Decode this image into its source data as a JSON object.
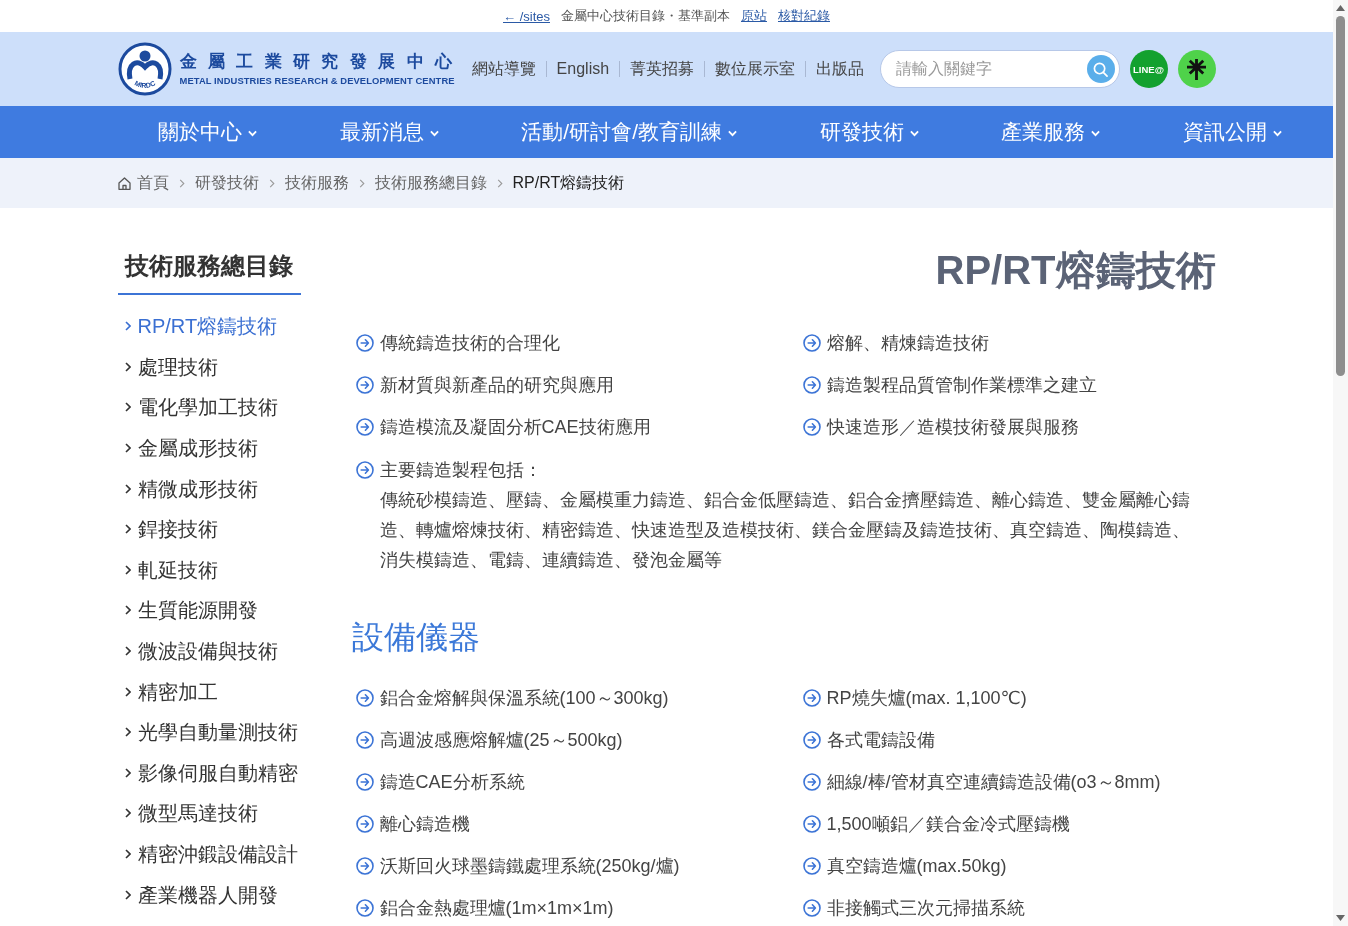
{
  "top_bar": {
    "back_link": "← /sites",
    "caption": "金屬中心技術目錄・基準副本",
    "links": [
      "原站",
      "核對紀錄"
    ]
  },
  "header": {
    "logo": {
      "emblem_text": "MIRDC",
      "name": "金屬工業研究發展中心",
      "name_en": "METAL INDUSTRIES RESEARCH & DEVELOPMENT CENTRE"
    },
    "links": [
      "網站導覽",
      "English",
      "菁英招募",
      "數位展示室",
      "出版品"
    ],
    "search": {
      "placeholder": "請輸入關鍵字"
    },
    "social_buttons": [
      {
        "kind": "label",
        "label": "LINE@"
      },
      {
        "kind": "asterisk"
      }
    ]
  },
  "main_nav": [
    "關於中心",
    "最新消息",
    "活動/研討會/教育訓練",
    "研發技術",
    "產業服務",
    "資訊公開"
  ],
  "breadcrumb": {
    "items": [
      "首頁",
      "研發技術",
      "技術服務",
      "技術服務總目錄"
    ],
    "current": "RP/RT熔鑄技術"
  },
  "sidebar": {
    "title": "技術服務總目錄",
    "items": [
      {
        "label": "RP/RT熔鑄技術",
        "selected": true
      },
      {
        "label": "處理技術",
        "selected": false
      },
      {
        "label": "電化學加工技術",
        "selected": false
      },
      {
        "label": "金屬成形技術",
        "selected": false
      },
      {
        "label": "精微成形技術",
        "selected": false
      },
      {
        "label": "銲接技術",
        "selected": false
      },
      {
        "label": "軋延技術",
        "selected": false
      },
      {
        "label": "生質能源開發",
        "selected": false
      },
      {
        "label": "微波設備與技術",
        "selected": false
      },
      {
        "label": "精密加工",
        "selected": false
      },
      {
        "label": "光學自動量測技術",
        "selected": false
      },
      {
        "label": "影像伺服自動精密",
        "selected": false
      },
      {
        "label": "微型馬達技術",
        "selected": false
      },
      {
        "label": "精密沖鍛設備設計",
        "selected": false
      },
      {
        "label": "產業機器人開發",
        "selected": false
      }
    ]
  },
  "content": {
    "title": "RP/RT熔鑄技術",
    "services": [
      "傳統鑄造技術的合理化",
      "熔解、精煉鑄造技術",
      "新材質與新產品的研究與應用",
      "鑄造製程品質管制作業標準之建立",
      "鑄造模流及凝固分析CAE技術應用",
      "快速造形／造模技術發展與服務"
    ],
    "process": {
      "label": "主要鑄造製程包括：",
      "text": "傳統砂模鑄造、壓鑄、金屬模重力鑄造、鋁合金低壓鑄造、鋁合金擠壓鑄造、離心鑄造、雙金屬離心鑄造、轉爐熔煉技術、精密鑄造、快速造型及造模技術、鎂合金壓鑄及鑄造技術、真空鑄造、陶模鑄造、消失模鑄造、電鑄、連續鑄造、發泡金屬等"
    },
    "equipment_heading": "設備儀器",
    "equipment": [
      "鋁合金熔解與保溫系統(100～300kg)",
      "RP燒失爐(max. 1,100℃)",
      "高週波感應熔解爐(25～500kg)",
      "各式電鑄設備",
      "鑄造CAE分析系統",
      "細線/棒/管材真空連續鑄造設備(o3～8mm)",
      "離心鑄造機",
      "1,500噸鋁／鎂合金冷式壓鑄機",
      "沃斯回火球墨鑄鐵處理系統(250kg/爐)",
      "真空鑄造爐(max.50kg)",
      "鋁合金熱處理爐(1m×1m×1m)",
      "非接觸式三次元掃描系統"
    ]
  }
}
